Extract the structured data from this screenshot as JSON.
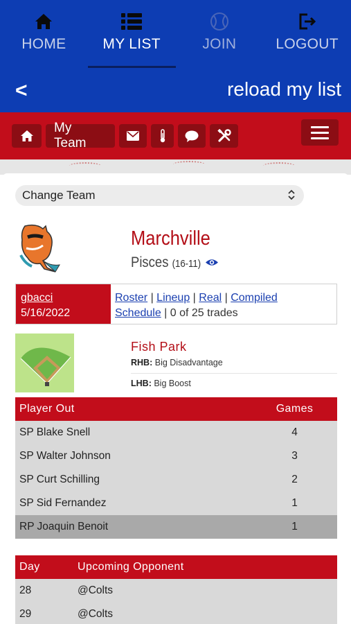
{
  "nav": {
    "items": [
      {
        "label": "HOME",
        "icon": "home-icon"
      },
      {
        "label": "MY LIST",
        "icon": "list-icon"
      },
      {
        "label": "JOIN",
        "icon": "baseball-icon"
      },
      {
        "label": "LOGOUT",
        "icon": "logout-icon"
      }
    ],
    "active_index": 1
  },
  "subbar": {
    "back": "<",
    "reload": "reload my list"
  },
  "toolbar": {
    "my_team": "My Team",
    "icons": [
      "home-icon",
      "mail-icon",
      "thermometer-icon",
      "chat-icon",
      "tools-icon",
      "menu-icon"
    ]
  },
  "change_team": {
    "value": "Change Team"
  },
  "team": {
    "name": "Marchville",
    "nickname": "Pisces",
    "record": "(16-11)"
  },
  "info": {
    "owner": "gbacci",
    "date": "5/16/2022",
    "links": [
      "Roster",
      "Lineup",
      "Real",
      "Compiled",
      "Schedule"
    ],
    "trades": "0 of 25 trades"
  },
  "park": {
    "name": "Fish Park",
    "rhb_label": "RHB:",
    "rhb_value": "Big Disadvantage",
    "lhb_label": "LHB:",
    "lhb_value": "Big Boost"
  },
  "players_out": {
    "headers": [
      "Player Out",
      "Games"
    ],
    "rows": [
      {
        "player": "SP Blake Snell",
        "games": "4"
      },
      {
        "player": "SP Walter Johnson",
        "games": "3"
      },
      {
        "player": "SP Curt Schilling",
        "games": "2"
      },
      {
        "player": "SP Sid Fernandez",
        "games": "1"
      },
      {
        "player": "RP Joaquin Benoit",
        "games": "1"
      }
    ]
  },
  "opponents": {
    "headers": [
      "Day",
      "Upcoming Opponent"
    ],
    "rows": [
      {
        "day": "28",
        "opponent": "@Colts"
      },
      {
        "day": "29",
        "opponent": "@Colts"
      }
    ]
  },
  "colors": {
    "nav_blue": "#0d3db3",
    "team_red": "#c20d1b",
    "dark_red": "#8c0d14",
    "row_gray": "#d9d9d9"
  }
}
